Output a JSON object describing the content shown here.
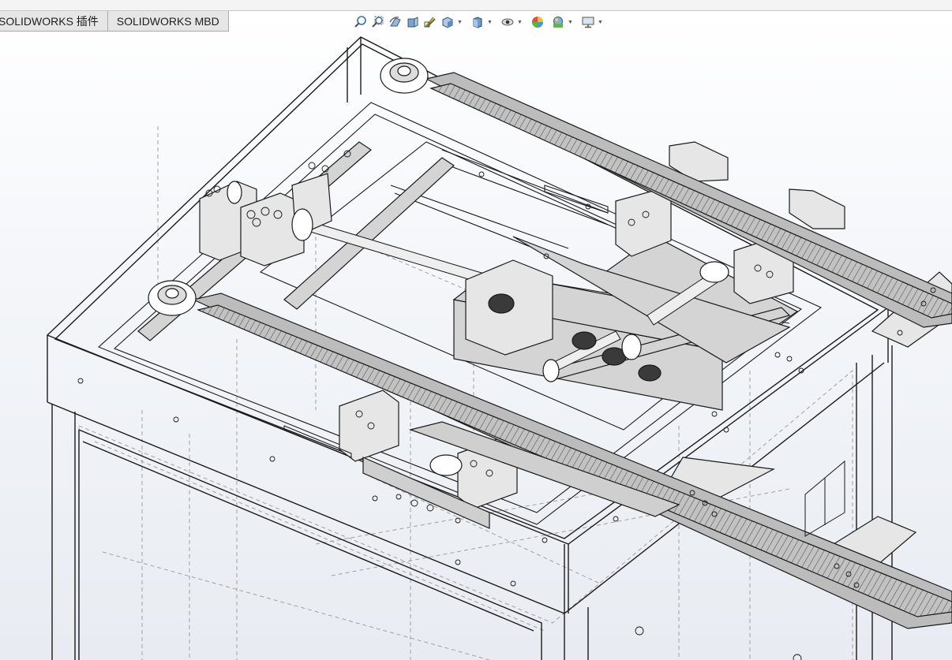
{
  "command_manager": {
    "tabs": [
      {
        "label": "SOLIDWORKS 插件"
      },
      {
        "label": "SOLIDWORKS MBD"
      }
    ]
  },
  "heads_up_toolbar": {
    "items": [
      {
        "icon": "zoom-to-fit-icon",
        "has_dropdown": false
      },
      {
        "icon": "zoom-to-area-icon",
        "has_dropdown": false
      },
      {
        "icon": "previous-view-icon",
        "has_dropdown": false
      },
      {
        "icon": "section-view-icon",
        "has_dropdown": false
      },
      {
        "icon": "dynamic-annotation-views-icon",
        "has_dropdown": false
      },
      {
        "icon": "view-orientation-icon",
        "has_dropdown": true
      },
      {
        "icon": "display-style-icon",
        "has_dropdown": true
      },
      {
        "icon": "hide-show-items-icon",
        "has_dropdown": true
      },
      {
        "icon": "edit-appearance-icon",
        "has_dropdown": false
      },
      {
        "icon": "apply-scene-icon",
        "has_dropdown": true
      },
      {
        "icon": "view-settings-icon",
        "has_dropdown": true
      }
    ]
  },
  "colors": {
    "viewport_top": "#ffffff",
    "viewport_bottom": "#e8ecf2",
    "edge_line": "#1a1a1a",
    "hidden_line": "#9a9a9a",
    "rail_fill": "#b9b9b9",
    "tab_background": "#e6e6e6"
  }
}
